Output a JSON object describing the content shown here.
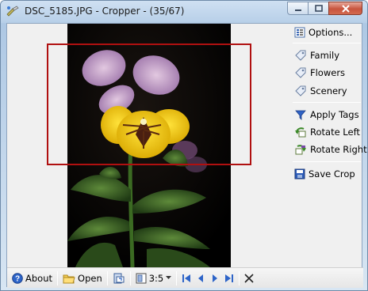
{
  "window": {
    "title": "DSC_5185.JPG - Cropper - (35/67)"
  },
  "sidebar": {
    "options_label": "Options...",
    "tags": [
      {
        "label": "Family",
        "icon": "tag-icon"
      },
      {
        "label": "Flowers",
        "icon": "tag-icon"
      },
      {
        "label": "Scenery",
        "icon": "tag-icon"
      }
    ],
    "apply_tags_label": "Apply Tags",
    "rotate_left_label": "Rotate Left",
    "rotate_right_label": "Rotate Right",
    "save_crop_label": "Save Crop"
  },
  "statusbar": {
    "about_label": "About",
    "open_label": "Open",
    "aspect_ratio": "3:5"
  },
  "colors": {
    "crop_rect": "#b01010",
    "accent": "#2255cc",
    "close_button": "#c8543e"
  }
}
